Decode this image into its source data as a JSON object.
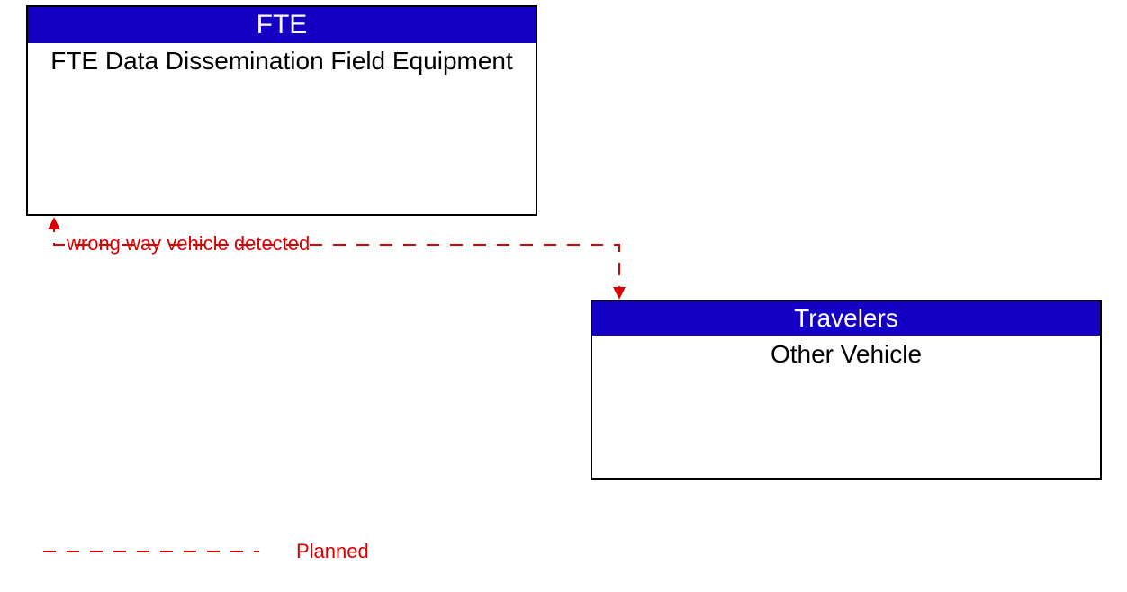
{
  "boxes": {
    "fte": {
      "header": "FTE",
      "body": "FTE Data Dissemination Field Equipment"
    },
    "travelers": {
      "header": "Travelers",
      "body": "Other Vehicle"
    }
  },
  "flow": {
    "label": "wrong way vehicle detected"
  },
  "legend": {
    "planned": "Planned"
  },
  "colors": {
    "header_bg": "#1400c4",
    "flow_red": "#d90000"
  }
}
